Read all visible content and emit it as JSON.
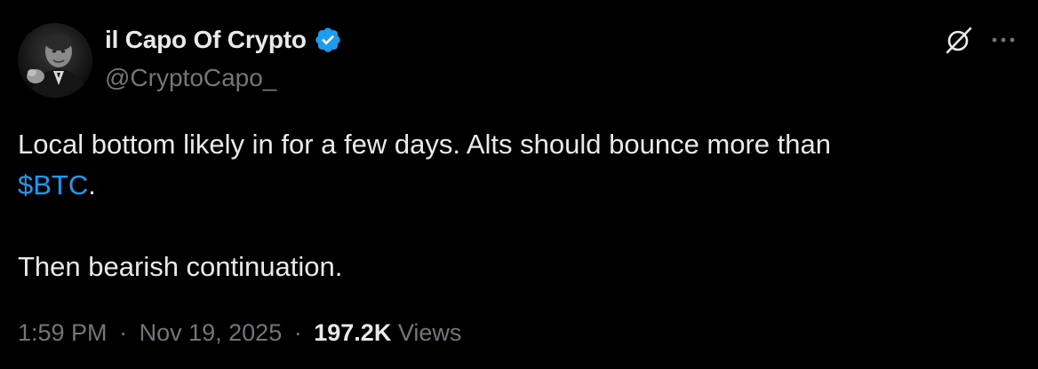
{
  "author": {
    "display_name": "il Capo Of Crypto",
    "handle": "@CryptoCapo_",
    "verified_color": "#1d9bf0",
    "avatar_icon": "avatar-photo"
  },
  "header_icons": {
    "grok": "grok-icon",
    "more": "more-icon"
  },
  "tweet": {
    "line1": "Local bottom likely in for a few days. Alts should bounce more than",
    "cashtag": "$BTC",
    "line2_suffix": ".",
    "line3": "Then bearish continuation."
  },
  "meta": {
    "time": "1:59 PM",
    "separator": "·",
    "date": "Nov 19, 2025",
    "views_count": "197.2K",
    "views_label": "Views"
  },
  "colors": {
    "background": "#000000",
    "text": "#e7e9ea",
    "muted": "#71767b",
    "accent": "#1d9bf0"
  }
}
